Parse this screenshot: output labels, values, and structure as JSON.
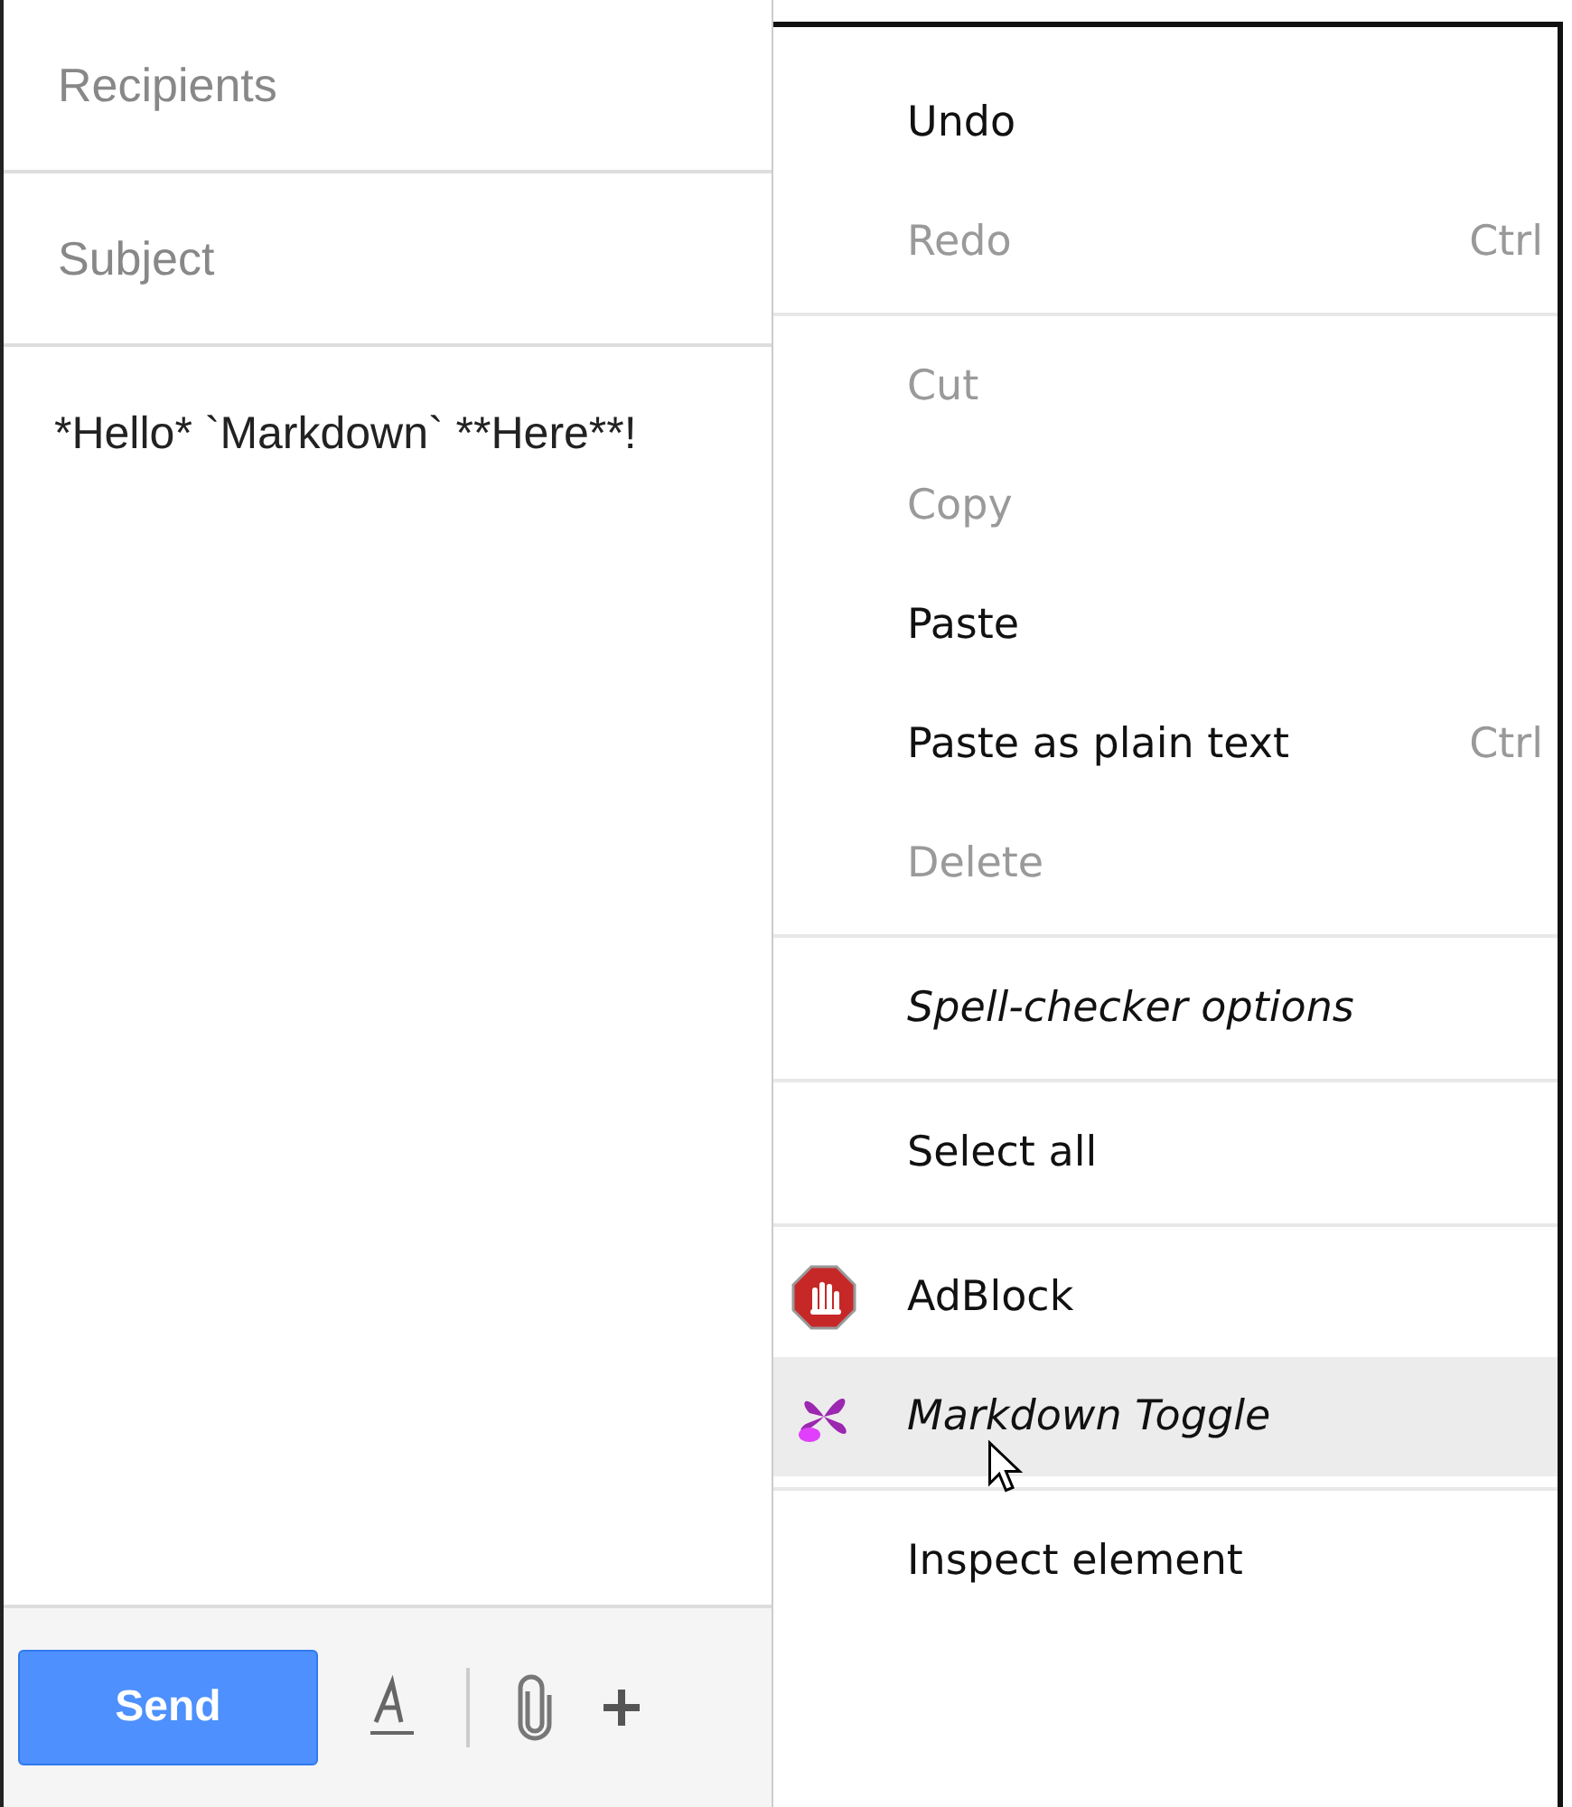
{
  "compose": {
    "recipients": {
      "placeholder": "Recipients"
    },
    "subject": {
      "placeholder": "Subject"
    },
    "body": {
      "value": "*Hello* `Markdown` **Here**!"
    },
    "send_button": {
      "label": "Send"
    }
  },
  "context_menu": {
    "groups": [
      {
        "items": [
          {
            "label": "Undo",
            "disabled": false
          },
          {
            "label": "Redo",
            "disabled": true,
            "shortcut": "Ctrl"
          }
        ]
      },
      {
        "items": [
          {
            "label": "Cut",
            "disabled": true
          },
          {
            "label": "Copy",
            "disabled": true
          },
          {
            "label": "Paste",
            "disabled": false
          },
          {
            "label": "Paste as plain text",
            "disabled": false,
            "shortcut": "Ctrl"
          },
          {
            "label": "Delete",
            "disabled": true
          }
        ]
      },
      {
        "items": [
          {
            "label": "Spell-checker options",
            "disabled": false,
            "italic": true
          }
        ]
      },
      {
        "items": [
          {
            "label": "Select all",
            "disabled": false
          }
        ]
      },
      {
        "items": [
          {
            "label": "AdBlock",
            "disabled": false,
            "kind": "adblock",
            "selected": false
          },
          {
            "label": "Markdown Toggle",
            "disabled": false,
            "italic": true,
            "kind": "markdown",
            "selected": true
          }
        ]
      },
      {
        "items": [
          {
            "label": "Inspect element",
            "disabled": false
          }
        ]
      }
    ]
  }
}
